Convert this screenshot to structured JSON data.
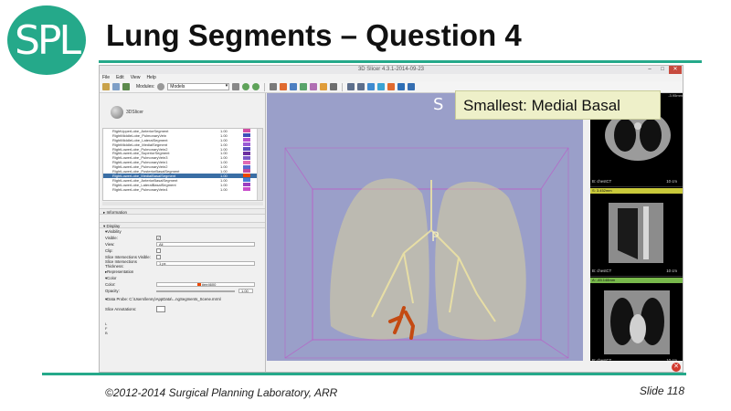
{
  "slide": {
    "logo_text": "SPL",
    "title": "Lung Segments – Question 4",
    "footer_left": "©2012-2014 Surgical Planning Laboratory, ARR",
    "footer_right": "Slide 118",
    "accent": "#25a98a"
  },
  "app": {
    "window_title": "3D Slicer 4.3.1-2014-09-23",
    "menu": [
      "File",
      "Edit",
      "View",
      "Help"
    ],
    "modules_label": "Modules:",
    "module_selected": "Models",
    "brand_label": "3DSlicer"
  },
  "segments": {
    "rows": [
      {
        "name": "RightUpperLobe_AnteriorSegment",
        "value": "1.00",
        "color": "#d24fa6"
      },
      {
        "name": "RightMiddleLobe_PulmonaryVein",
        "value": "1.00",
        "color": "#3f4fb8"
      },
      {
        "name": "RightMiddleLobe_LateralSegment",
        "value": "1.00",
        "color": "#b54fd0"
      },
      {
        "name": "RightMiddleLobe_MedialSegment",
        "value": "1.00",
        "color": "#9a5bd4"
      },
      {
        "name": "RightLowerLobe_PulmonaryVein2",
        "value": "1.00",
        "color": "#5a4bbd"
      },
      {
        "name": "RightLowerLobe_SuperiorSegment",
        "value": "1.00",
        "color": "#6d2fa0"
      },
      {
        "name": "RightLowerLobe_PulmonaryVein3",
        "value": "1.00",
        "color": "#7b58c8"
      },
      {
        "name": "RightLowerLobe_PulmonaryVein1",
        "value": "1.00",
        "color": "#e06ab3"
      },
      {
        "name": "RightLowerLobe_PulmonaryVein2",
        "value": "1.00",
        "color": "#5868cf"
      },
      {
        "name": "RightLowerLobe_PosteriorBasalSegment",
        "value": "1.00",
        "color": "#c04aa0"
      },
      {
        "name": "RightLowerLobe_MedialBasalSegment",
        "value": "1.00",
        "color": "#ee4600",
        "selected": true
      },
      {
        "name": "RightLowerLobe_AnteriorBasalSegment",
        "value": "1.00",
        "color": "#4b7cd6"
      },
      {
        "name": "RightLowerLobe_LateralBasalSegment",
        "value": "1.00",
        "color": "#9b3fc0"
      },
      {
        "name": "RightLowerLobe_PulmonaryVein4",
        "value": "1.00",
        "color": "#c94fcb"
      }
    ]
  },
  "panel": {
    "information": "Information",
    "display": "Display",
    "visibility": "Visibility",
    "visible_label": "Visible:",
    "visible_check": "✓",
    "view_label": "View:",
    "view_value": "All",
    "clip_label": "Clip:",
    "slice_intersections_label": "Slice Intersections Visible:",
    "slice_thickness_label": "Slice Intersections Thickness:",
    "slice_thickness_value": "1 px",
    "representation": "Representation",
    "color_section": "Color",
    "color_label": "Color:",
    "color_value": "#ee4600",
    "opacity_label": "Opacity:",
    "opacity_value": "1.00",
    "data_probe": "Data Probe: C:\\Users\\lenny\\AppData\\...ngSegments_Scene.mrml",
    "slice_annotations": "Slice Annotations:",
    "probe_lines": [
      "L",
      "F",
      "B"
    ]
  },
  "view3d": {
    "orientation_top": "S",
    "orientation_center": "P",
    "overlay_text": "Smallest: Medial Basal"
  },
  "slice_views": [
    {
      "bar": "R",
      "label": "B: chestCT",
      "scale": "10 cm",
      "bar_value": "S: 3.452mm"
    },
    {
      "bar": "Y",
      "label": "B: chestCT",
      "scale": "10 cm",
      "bar_value": "A: -45.148mm"
    },
    {
      "bar": "G",
      "label": "B: chestCT",
      "scale": "10 cm"
    }
  ],
  "slice_view_top_readout": "-3.95mm"
}
